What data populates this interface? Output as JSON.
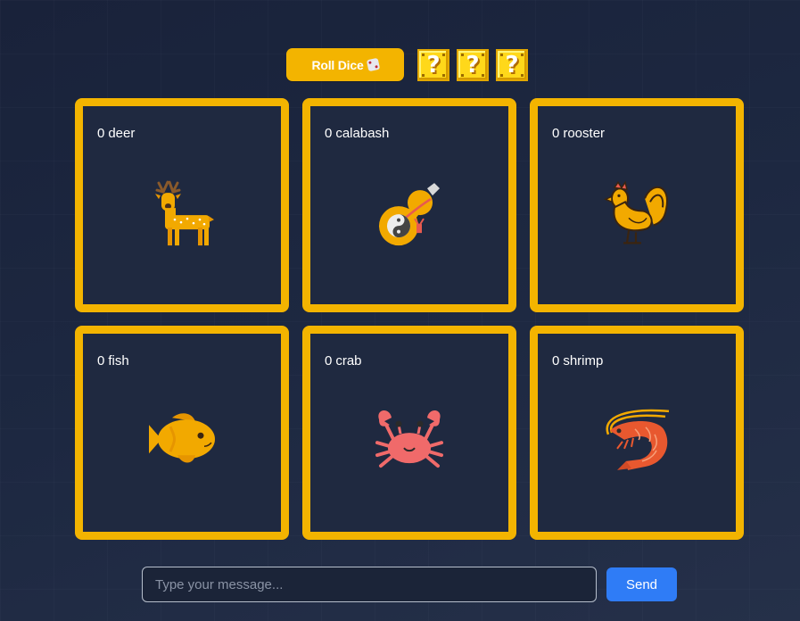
{
  "toolbar": {
    "roll_label": "Roll Dice",
    "roll_icon": "die-icon",
    "dice": [
      {
        "face": "?",
        "icon": "question-block-icon"
      },
      {
        "face": "?",
        "icon": "question-block-icon"
      },
      {
        "face": "?",
        "icon": "question-block-icon"
      }
    ]
  },
  "board": {
    "cells": [
      {
        "count": "0",
        "name": "deer",
        "icon": "deer-icon"
      },
      {
        "count": "0",
        "name": "calabash",
        "icon": "calabash-icon"
      },
      {
        "count": "0",
        "name": "rooster",
        "icon": "rooster-icon"
      },
      {
        "count": "0",
        "name": "fish",
        "icon": "fish-icon"
      },
      {
        "count": "0",
        "name": "crab",
        "icon": "crab-icon"
      },
      {
        "count": "0",
        "name": "shrimp",
        "icon": "shrimp-icon"
      }
    ]
  },
  "chat": {
    "placeholder": "Type your message...",
    "value": "",
    "send_label": "Send"
  },
  "colors": {
    "accent": "#f3b400",
    "send": "#2f7cf6",
    "background": "#1d2841",
    "cell_bg": "#1f2940"
  }
}
